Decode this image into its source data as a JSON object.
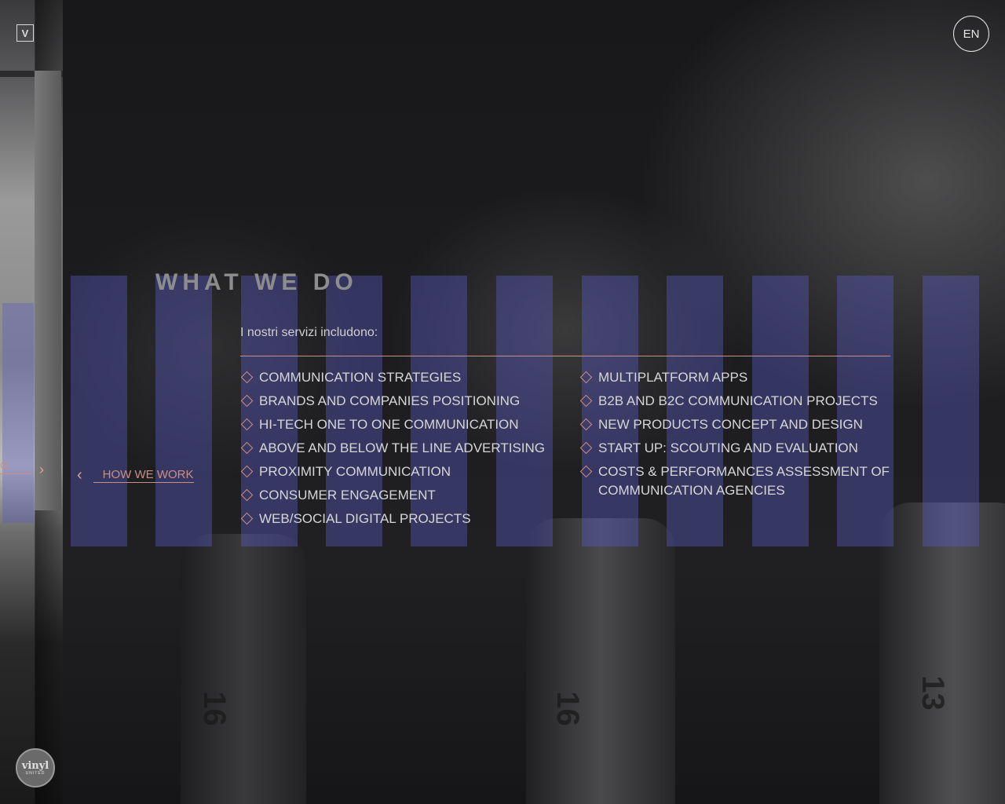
{
  "header": {
    "logo_text": "V",
    "language": "EN"
  },
  "previous_slide": {
    "label_fragment": "O",
    "next_chevron": "›"
  },
  "section": {
    "title": "WHAT WE DO",
    "intro": "I nostri servizi includono:"
  },
  "services_left": [
    "COMMUNICATION STRATEGIES",
    "BRANDS AND COMPANIES POSITIONING",
    "HI-TECH ONE TO ONE COMMUNICATION",
    "ABOVE AND BELOW THE LINE ADVERTISING",
    "PROXIMITY COMMUNICATION",
    "CONSUMER ENGAGEMENT",
    "WEB/SOCIAL DIGITAL PROJECTS"
  ],
  "services_right": [
    "MULTIPLATFORM APPS",
    "B2B AND B2C COMMUNICATION PROJECTS",
    "NEW PRODUCTS CONCEPT AND DESIGN",
    "START UP: SCOUTING AND EVALUATION",
    "COSTS & PERFORMANCES ASSESSMENT OF COMMUNICATION AGENCIES"
  ],
  "nav": {
    "prev_chevron": "‹",
    "prev_label": "HOW WE WORK"
  },
  "badge": {
    "name": "vinyl",
    "sub": "UNITED"
  },
  "wrench_numbers": [
    "16",
    "16",
    "13"
  ],
  "colors": {
    "accent": "#c98f84",
    "bar_overlay": "#5858be",
    "title": "#8d8d8d",
    "text": "#d6d6d6"
  }
}
